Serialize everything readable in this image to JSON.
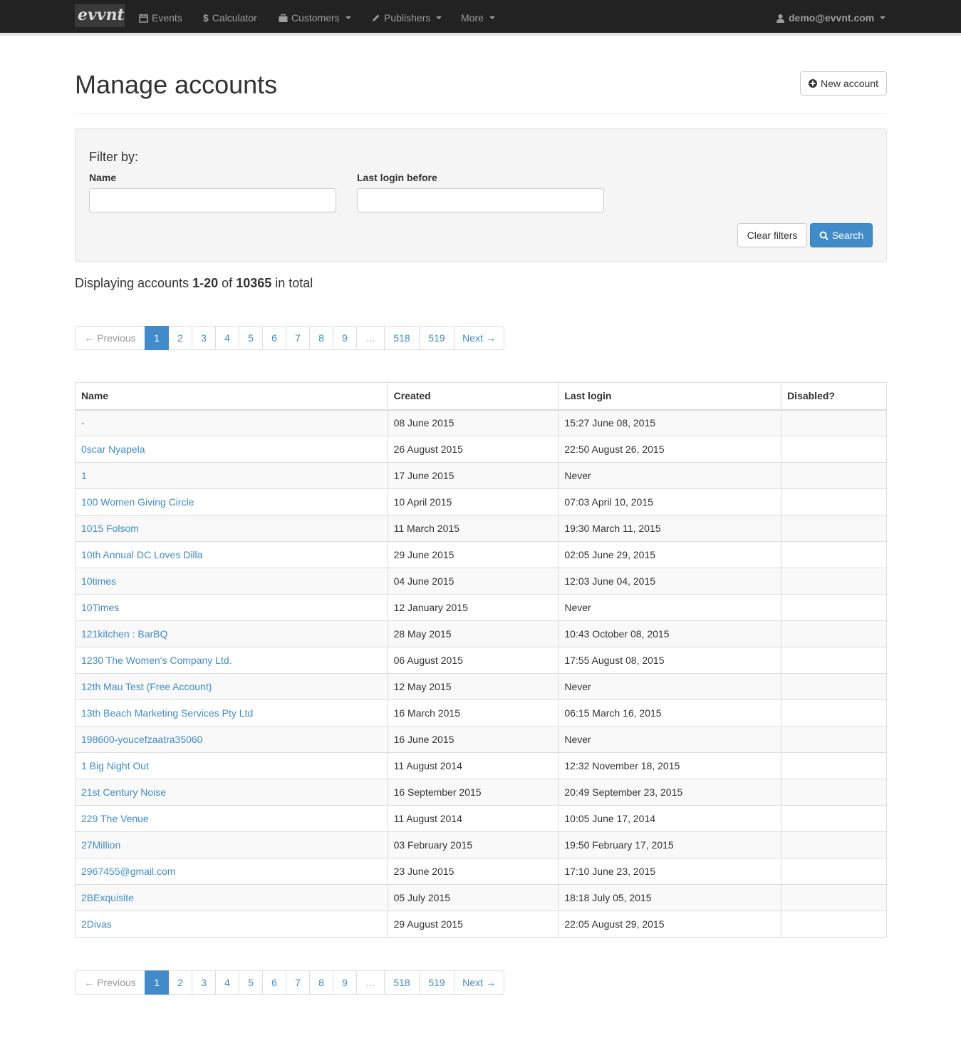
{
  "navbar": {
    "brand": "evvnt",
    "items": [
      {
        "label": "Events",
        "icon": "calendar-icon",
        "dropdown": false
      },
      {
        "label": "Calculator",
        "icon": "dollar-icon",
        "dropdown": false
      },
      {
        "label": "Customers",
        "icon": "briefcase-icon",
        "dropdown": true
      },
      {
        "label": "Publishers",
        "icon": "pencil-icon",
        "dropdown": true
      },
      {
        "label": "More",
        "icon": "",
        "dropdown": true
      }
    ],
    "user": "demo@evvnt.com"
  },
  "header": {
    "title": "Manage accounts",
    "new_account_label": "New account"
  },
  "filter": {
    "title": "Filter by:",
    "name_label": "Name",
    "name_value": "",
    "last_login_label": "Last login before",
    "last_login_value": "",
    "clear_label": "Clear filters",
    "search_label": "Search"
  },
  "summary": {
    "prefix": "Displaying accounts",
    "range": "1-20",
    "of": "of",
    "total": "10365",
    "suffix": "in total"
  },
  "pagination": {
    "previous": "← Previous",
    "pages": [
      "1",
      "2",
      "3",
      "4",
      "5",
      "6",
      "7",
      "8",
      "9",
      "…",
      "518",
      "519"
    ],
    "active": "1",
    "next": "Next →"
  },
  "table": {
    "headers": [
      "Name",
      "Created",
      "Last login",
      "Disabled?"
    ],
    "rows": [
      [
        "-",
        "08 June 2015",
        "15:27 June 08, 2015",
        ""
      ],
      [
        "0scar Nyapela",
        "26 August 2015",
        "22:50 August 26, 2015",
        ""
      ],
      [
        "1",
        "17 June 2015",
        "Never",
        ""
      ],
      [
        "100 Women Giving Circle",
        "10 April 2015",
        "07:03 April 10, 2015",
        ""
      ],
      [
        "1015 Folsom",
        "11 March 2015",
        "19:30 March 11, 2015",
        ""
      ],
      [
        "10th Annual DC Loves Dilla",
        "29 June 2015",
        "02:05 June 29, 2015",
        ""
      ],
      [
        "10times",
        "04 June 2015",
        "12:03 June 04, 2015",
        ""
      ],
      [
        "10Times",
        "12 January 2015",
        "Never",
        ""
      ],
      [
        "121kitchen : BarBQ",
        "28 May 2015",
        "10:43 October 08, 2015",
        ""
      ],
      [
        "1230 The Women's Company Ltd.",
        "06 August 2015",
        "17:55 August 08, 2015",
        ""
      ],
      [
        "12th Mau Test (Free Account)",
        "12 May 2015",
        "Never",
        ""
      ],
      [
        "13th Beach Marketing Services Pty Ltd",
        "16 March 2015",
        "06:15 March 16, 2015",
        ""
      ],
      [
        "198600-youcefzaatra35060",
        "16 June 2015",
        "Never",
        ""
      ],
      [
        "1 Big Night Out",
        "11 August 2014",
        "12:32 November 18, 2015",
        ""
      ],
      [
        "21st Century Noise",
        "16 September 2015",
        "20:49 September 23, 2015",
        ""
      ],
      [
        "229 The Venue",
        "11 August 2014",
        "10:05 June 17, 2014",
        ""
      ],
      [
        "27Million",
        "03 February 2015",
        "19:50 February 17, 2015",
        ""
      ],
      [
        "2967455@gmail.com",
        "23 June 2015",
        "17:10 June 23, 2015",
        ""
      ],
      [
        "2BExquisite",
        "05 July 2015",
        "18:18 July 05, 2015",
        ""
      ],
      [
        "2Divas",
        "29 August 2015",
        "22:05 August 29, 2015",
        ""
      ]
    ]
  },
  "colors": {
    "navbar_bg": "#222222",
    "link": "#428bca",
    "primary": "#428bca"
  }
}
